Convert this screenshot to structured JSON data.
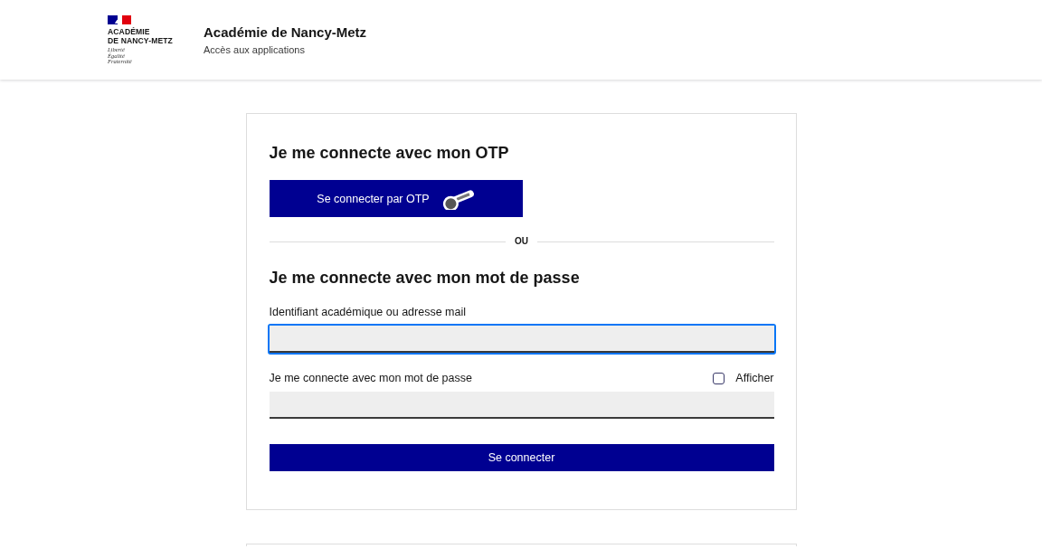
{
  "header": {
    "logo": {
      "lines": [
        "ACADÉMIE",
        "DE NANCY-METZ"
      ],
      "motto": [
        "Liberté",
        "Égalité",
        "Fraternité"
      ]
    },
    "title": "Académie de Nancy-Metz",
    "subtitle": "Accès aux applications"
  },
  "otp_section": {
    "heading": "Je me connecte avec mon OTP",
    "button": "Se connecter par OTP"
  },
  "separator": "OU",
  "password_section": {
    "heading": "Je me connecte avec mon mot de passe",
    "fields": [
      {
        "label": "Identifiant académique ou adresse mail",
        "focused": true
      },
      {
        "label": "Je me connecte avec mon mot de passe",
        "focused": false,
        "show_toggle": {
          "label": "Afficher",
          "checked": false
        }
      }
    ],
    "submit": "Se connecter"
  }
}
